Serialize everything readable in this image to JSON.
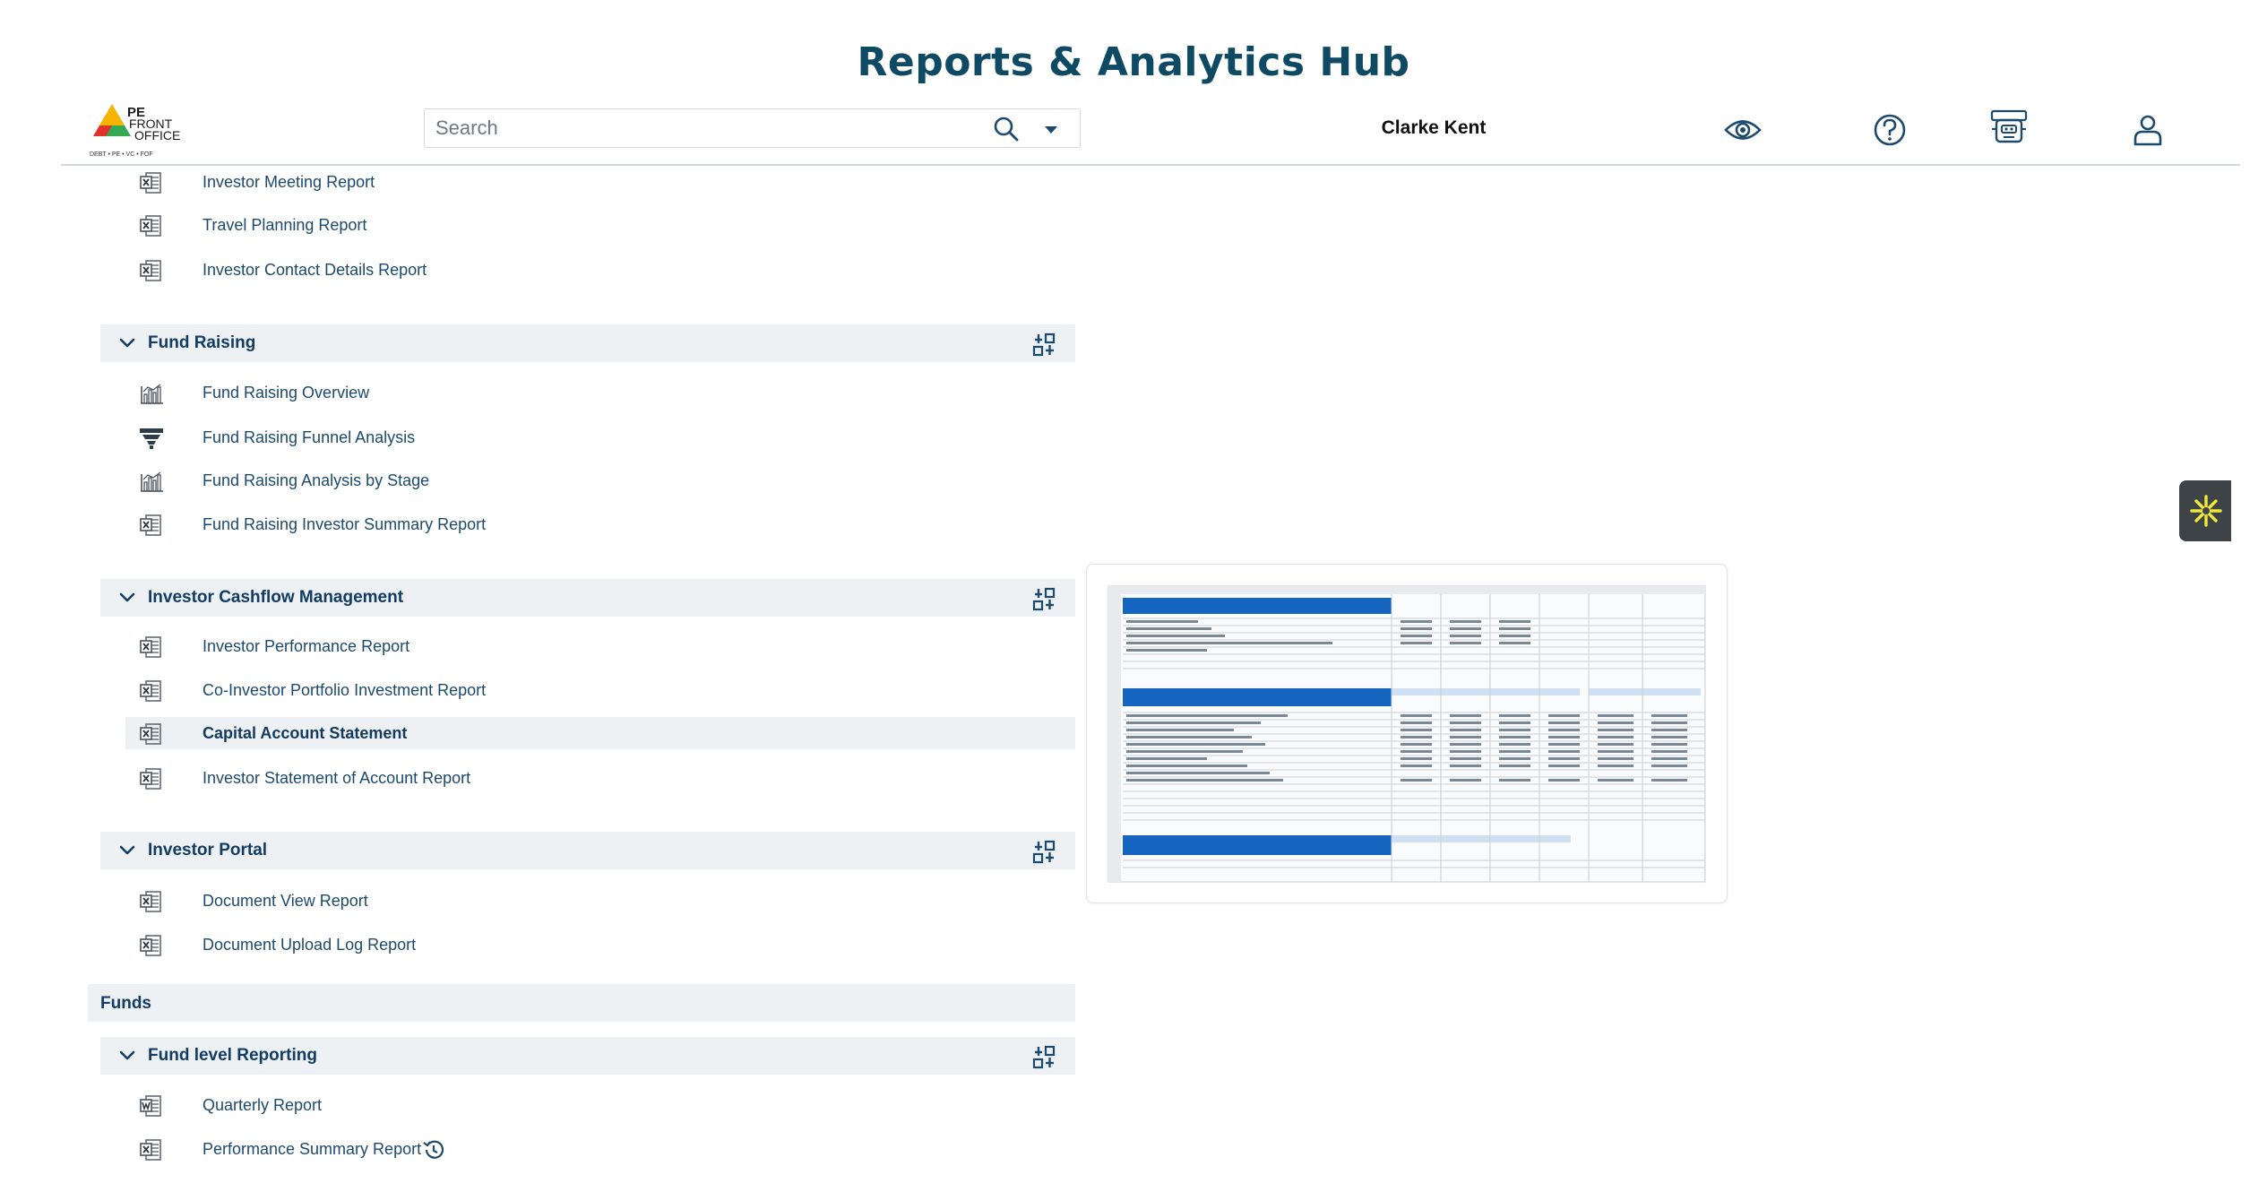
{
  "page": {
    "title": "Reports & Analytics Hub"
  },
  "header": {
    "logo": {
      "brand_top": "PE",
      "brand_mid": "FRONT",
      "brand_bottom": "OFFICE",
      "tagline": "DEBT • PE • VC • FOF"
    },
    "search": {
      "placeholder": "Search"
    },
    "user_name": "Clarke Kent",
    "icons": [
      "eye-icon",
      "help-icon",
      "robot-icon",
      "user-icon"
    ]
  },
  "reports": {
    "top_items": [
      {
        "label": "Investor Meeting Report",
        "icon": "excel-file-icon"
      },
      {
        "label": "Travel Planning Report",
        "icon": "excel-file-icon"
      },
      {
        "label": "Investor Contact Details Report",
        "icon": "excel-file-icon"
      }
    ],
    "sections": [
      {
        "title": "Fund Raising",
        "items": [
          {
            "label": "Fund Raising Overview",
            "icon": "chart-icon"
          },
          {
            "label": "Fund Raising Funnel Analysis",
            "icon": "funnel-icon"
          },
          {
            "label": "Fund Raising Analysis by Stage",
            "icon": "chart-icon"
          },
          {
            "label": "Fund Raising Investor Summary Report",
            "icon": "excel-file-icon"
          }
        ]
      },
      {
        "title": "Investor Cashflow Management",
        "items": [
          {
            "label": "Investor Performance Report",
            "icon": "excel-file-icon"
          },
          {
            "label": "Co-Investor Portfolio Investment Report",
            "icon": "excel-file-icon"
          },
          {
            "label": "Capital Account Statement",
            "icon": "excel-file-icon",
            "selected": true
          },
          {
            "label": "Investor Statement of Account Report",
            "icon": "excel-file-icon"
          }
        ]
      },
      {
        "title": "Investor Portal",
        "items": [
          {
            "label": "Document View Report",
            "icon": "excel-file-icon"
          },
          {
            "label": "Document Upload Log Report",
            "icon": "excel-file-icon"
          }
        ]
      }
    ],
    "group": {
      "title": "Funds"
    },
    "fund_sections": [
      {
        "title": "Fund level Reporting",
        "items": [
          {
            "label": "Quarterly Report",
            "icon": "word-file-icon"
          },
          {
            "label": "Performance Summary Report",
            "icon": "excel-file-icon",
            "extra_icon": "history-icon"
          }
        ]
      }
    ]
  },
  "preview": {
    "description_visible": "spreadsheet thumbnail of Capital Account Statement"
  },
  "colors": {
    "title": "#0e4a63",
    "accent": "#1c4a6e",
    "section_bg": "#eef1f4",
    "logo_red": "#e0312b",
    "logo_yellow": "#f4b400",
    "logo_green": "#35a853"
  }
}
